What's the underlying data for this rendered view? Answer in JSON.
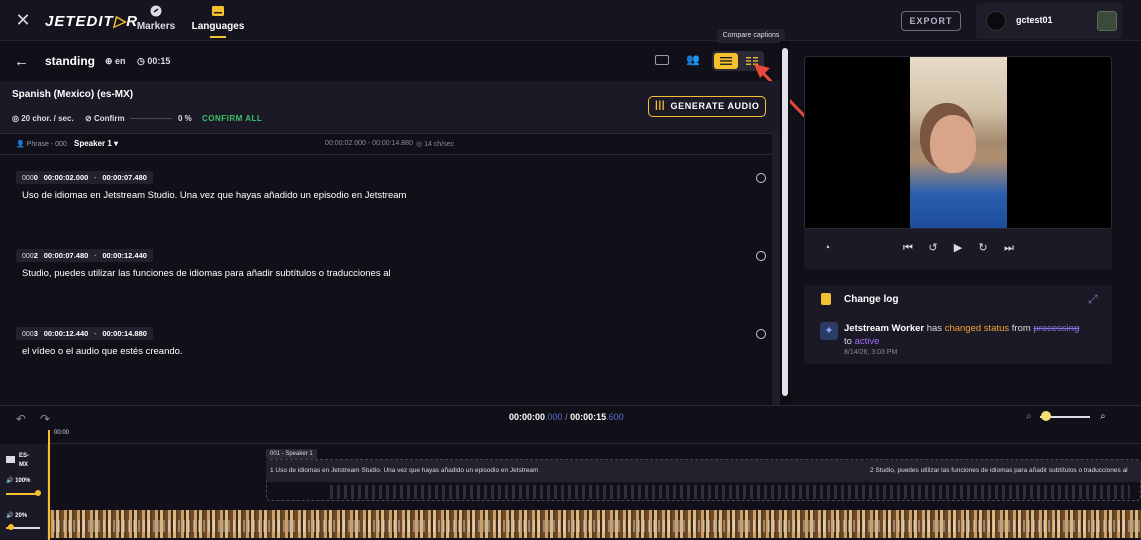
{
  "app": {
    "logo_main": "JETEDIT",
    "logo_accent": "▷",
    "logo_end": "R"
  },
  "nav": {
    "markers": "Markers",
    "languages": "Languages"
  },
  "toolbar": {
    "export": "EXPORT",
    "username": "gctest01",
    "tooltip": "Compare captions"
  },
  "header": {
    "back": "←",
    "title": "standing",
    "lang_code": "en",
    "duration": "00:15"
  },
  "language_bar": {
    "name": "Spanish (Mexico) (es-MX)",
    "chars_per_sec": "20 chor. / sec.",
    "confirm_label": "Confirm",
    "confirm_progress": 0,
    "progress_pct": "0 %",
    "confirm_all": "CONFIRM ALL",
    "generate_audio": "GENERATE AUDIO"
  },
  "phrase": {
    "label": "Phrase - 000",
    "speaker": "Speaker 1",
    "time_range": "00:00:02.000 - 00:00:14.880",
    "rate": "14 ch/sec"
  },
  "segments": [
    {
      "idx_prefix": "000",
      "idx": "0",
      "start": "00:00:02.000",
      "end": "00:00:07.480",
      "text": "Uso de idiomas en Jetstream Studio. Una vez que hayas añadido un episodio en Jetstream"
    },
    {
      "idx_prefix": "000",
      "idx": "2",
      "start": "00:00:07.480",
      "end": "00:00:12.440",
      "text": "Studio, puedes utilizar las funciones de idiomas para añadir subtítulos o traducciones al"
    },
    {
      "idx_prefix": "000",
      "idx": "3",
      "start": "00:00:12.440",
      "end": "00:00:14.880",
      "text": "el vídeo o el audio que estés creando."
    }
  ],
  "changelog": {
    "title": "Change log",
    "actor": "Jetstream Worker",
    "has": " has ",
    "action": "changed status",
    "from": " from ",
    "old_status": "processing",
    "to": "to ",
    "new_status": "active",
    "date": "8/14/26, 3:03 PM"
  },
  "timeline": {
    "current": "00:00:00",
    "current_ms": ".000",
    "separator": " / ",
    "total": "00:00:15",
    "total_ms": ".600",
    "ruler_start": "00:00",
    "track_lang": "ES-\nMX",
    "track_volume": "100%",
    "track_volume_level": 1.0,
    "video_volume": "20%",
    "video_volume_level": 0.2,
    "sub_label": "001 - Speaker 1",
    "clip1": "1 Uso de idiomas en Jetstream Studio. Una vez que hayas añadido un episodio en Jetstream",
    "clip2": "2 Studio, puedes utilizar las funciones de idiomas para añadir subtítulos o traducciones al"
  },
  "colors": {
    "accent": "#f5c030",
    "confirm_green": "#3cc36a",
    "bg": "#111019"
  }
}
